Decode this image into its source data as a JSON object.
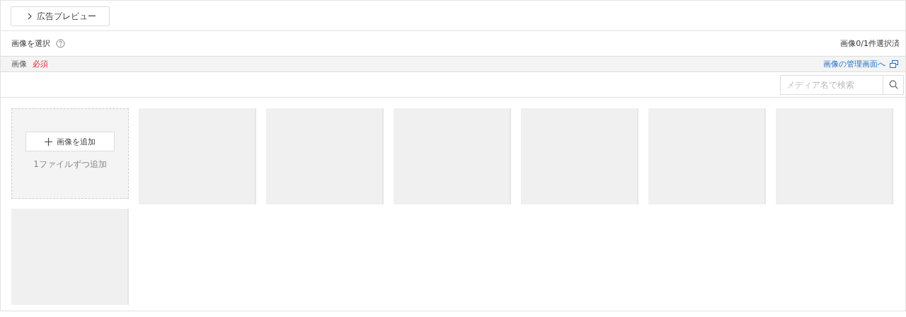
{
  "preview_button": {
    "label": "広告プレビュー",
    "expanded": false
  },
  "select_header": {
    "title": "画像を選択",
    "count": "画像0/1件選択済"
  },
  "field_bar": {
    "label": "画像",
    "required": "必須",
    "manage_link": "画像の管理画面へ"
  },
  "search": {
    "placeholder": "メディア名で検索"
  },
  "add_tile": {
    "button": "画像を追加",
    "hint": "1ファイルずつ追加"
  },
  "tiles": [
    {
      "kind": "placeholder"
    },
    {
      "kind": "placeholder"
    },
    {
      "kind": "placeholder"
    },
    {
      "kind": "placeholder"
    },
    {
      "kind": "placeholder"
    },
    {
      "kind": "placeholder"
    },
    {
      "kind": "placeholder"
    }
  ]
}
